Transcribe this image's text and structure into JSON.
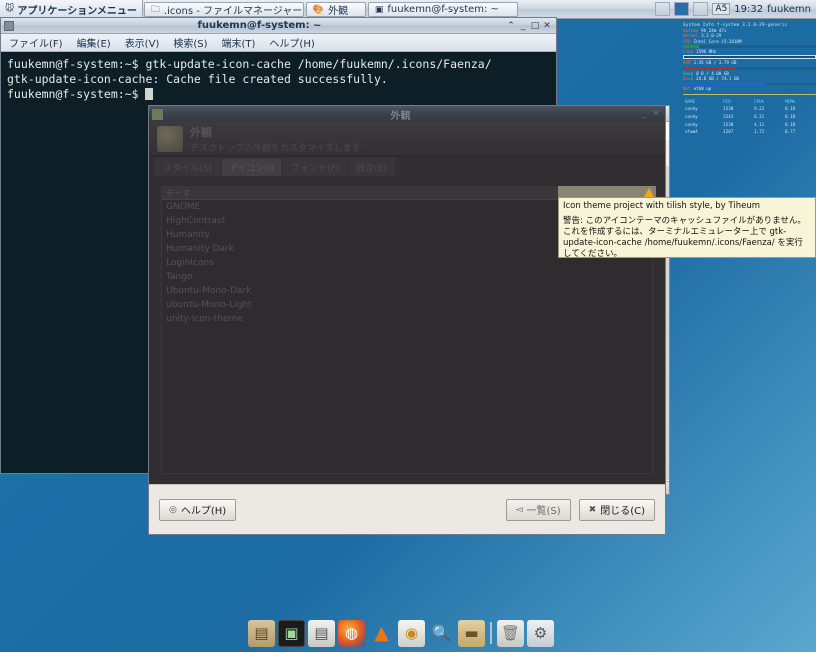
{
  "panel": {
    "app_menu_label": "アプリケーションメニュー",
    "app_menu_icon": "xfce-mouse-icon",
    "tasks": [
      {
        "label": ".icons - ファイルマネージャー",
        "icon": "folder-icon"
      },
      {
        "label": "外観",
        "icon": "appearance-icon"
      },
      {
        "label": "fuukemn@f-system: ~",
        "icon": "terminal-icon"
      }
    ],
    "tray": {
      "keyboard_layout": "A5",
      "clock": "19:32",
      "user": "fuukemn"
    }
  },
  "terminal": {
    "title": "fuukemn@f-system: ~",
    "menus": [
      "ファイル(F)",
      "編集(E)",
      "表示(V)",
      "検索(S)",
      "端末(T)",
      "ヘルプ(H)"
    ],
    "controls": {
      "shade": "⌃",
      "minimize": "_",
      "maximize": "□",
      "close": "✕"
    },
    "lines": [
      "fuukemn@f-system:~$ gtk-update-icon-cache /home/fuukemn/.icons/Faenza/",
      "gtk-update-icon-cache: Cache file created successfully.",
      "fuukemn@f-system:~$ "
    ]
  },
  "filemanager": {
    "search_placeholder": "",
    "search_value": "",
    "search_icon": "search-icon"
  },
  "appearance": {
    "window_title": "外観",
    "header_title": "外観",
    "header_subtitle": "デスクトップの外観をカスタマイズします",
    "tabs": [
      {
        "label": "スタイル(S)",
        "active": false
      },
      {
        "label": "アイコン(I)",
        "active": true
      },
      {
        "label": "フォント(F)",
        "active": false
      },
      {
        "label": "設定(E)",
        "active": false
      }
    ],
    "list_header": "テーマ",
    "themes": [
      "GNOME",
      "HighContrast",
      "Humanity",
      "Humanity Dark",
      "LoginIcons",
      "Tango",
      "Ubuntu-Mono-Dark",
      "ubuntu-Mono-Light",
      "unity-icon-theme"
    ],
    "buttons": {
      "help": "ヘルプ(H)",
      "list": "一覧(S)",
      "close": "閉じる(C)"
    },
    "button_icons": {
      "help": "help-icon",
      "list": "back-arrow-icon",
      "close": "close-x-icon"
    }
  },
  "tooltip": {
    "warn_icon": "warning-triangle-icon",
    "line1": "Icon theme project with tilish style, by Tiheum",
    "warning": "警告: このアイコンテーマのキャッシュファイルがありません。これを作成するには、ターミナルエミュレーター上で gtk-update-icon-cache /home/fuukemn/.icons/Faenza/ を実行してください。"
  },
  "conky": {
    "title": "System Info f-system  3.2.0-29-generic",
    "rows": [
      {
        "label": "Uptime",
        "value": "9h 24m 47s"
      },
      {
        "label": "Kernel",
        "value": "3.2.0-29"
      },
      {
        "label": "CPU",
        "value": "Intel Core i5-2410M"
      },
      {
        "label": "Freq",
        "value": "1596 MHz"
      },
      {
        "label": "RAM",
        "value": "1.45 GB / 3.79 GB"
      },
      {
        "label": "Swap",
        "value": "0 B / 4.00 GB"
      },
      {
        "label": "Disk",
        "value": "24.8 GB / 74.1 GB"
      },
      {
        "label": "Net",
        "value": "eth0 up"
      }
    ],
    "proc_header": [
      "NAME",
      "PID",
      "CPU%",
      "MEM%"
    ],
    "processes": [
      {
        "name": "conky",
        "pid": "1530",
        "cpu": "9.23",
        "mem": "0.18"
      },
      {
        "name": "conky",
        "pid": "2243",
        "cpu": "6.21",
        "mem": "0.18"
      },
      {
        "name": "conky",
        "pid": "1530",
        "cpu": "4.11",
        "mem": "0.18"
      },
      {
        "name": "xfwm4",
        "pid": "1207",
        "cpu": "1.72",
        "mem": "0.77"
      }
    ]
  },
  "dock": {
    "items": [
      {
        "name": "file-manager-icon",
        "glyph": "🗂"
      },
      {
        "name": "terminal-icon",
        "glyph": "▣"
      },
      {
        "name": "text-editor-icon",
        "glyph": "🗒"
      },
      {
        "name": "firefox-icon",
        "glyph": "◍"
      },
      {
        "name": "vlc-icon",
        "glyph": "▲"
      },
      {
        "name": "clock-app-icon",
        "glyph": "◉"
      },
      {
        "name": "search-icon",
        "glyph": "🔍"
      },
      {
        "name": "folder-icon",
        "glyph": "📁"
      },
      {
        "name": "trash-icon",
        "glyph": "🗑"
      },
      {
        "name": "settings-icon",
        "glyph": "⚙"
      }
    ]
  },
  "colors": {
    "desktop_blue": "#1d6fa8",
    "panel_grey": "#cdd7e2",
    "terminal_bg": "#0e1e27",
    "tooltip_bg": "#f7f4d8",
    "dialog_bg": "#ece9e4",
    "warning_orange": "#f0a818"
  }
}
